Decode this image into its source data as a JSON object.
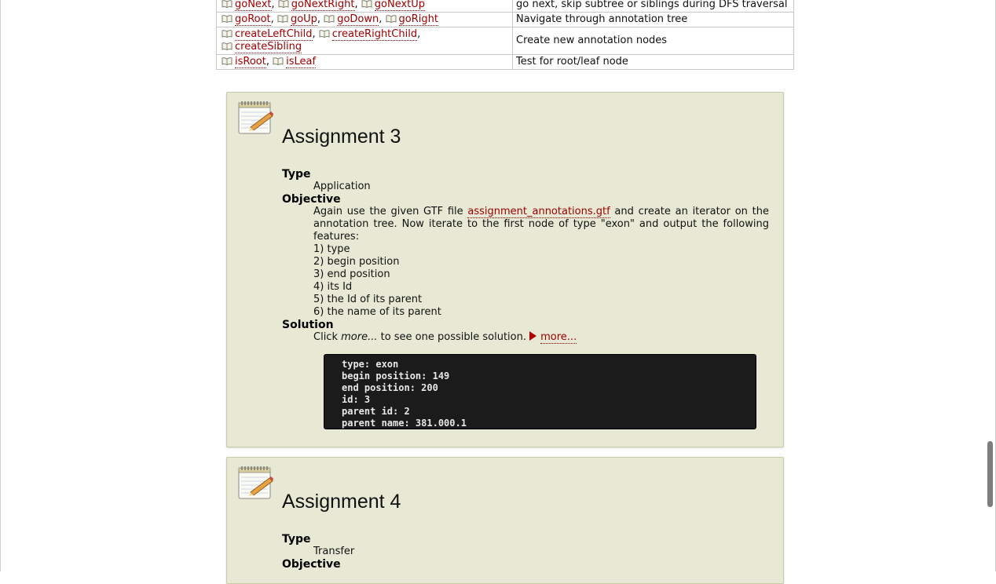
{
  "function_table": {
    "rows": [
      {
        "functions": [
          "goNext",
          "goNextRight",
          "goNextUp"
        ],
        "description": "go next, skip subtree or siblings during DFS traversal"
      },
      {
        "functions": [
          "goRoot",
          "goUp",
          "goDown",
          "goRight"
        ],
        "description": "Navigate through annotation tree"
      },
      {
        "functions": [
          "createLeftChild",
          "createRightChild",
          "createSibling"
        ],
        "description": "Create new annotation nodes"
      },
      {
        "functions": [
          "isRoot",
          "isLeaf"
        ],
        "description": "Test for root/leaf node"
      }
    ]
  },
  "assignment3": {
    "title": "Assignment 3",
    "type_label": "Type",
    "type_value": "Application",
    "objective_label": "Objective",
    "objective_text_1": "Again use the given GTF file ",
    "objective_link": "assignment_annotations.gtf",
    "objective_text_2": " and create an iterator on the annotation tree. Now iterate to the first node of type \"exon\" and output the following features:",
    "features": [
      "1) type",
      "2) begin position",
      "3) end position",
      "4) its Id",
      "5) the Id of its parent",
      "6) the name of its parent"
    ],
    "solution_label": "Solution",
    "solution_prefix": "Click ",
    "solution_em": "more...",
    "solution_suffix": " to see one possible solution.",
    "more_link": "more...",
    "code_lines": [
      "type: exon",
      "begin position: 149",
      "end position: 200",
      "id: 3",
      "parent id: 2",
      "parent name: 381.000.1"
    ]
  },
  "assignment4": {
    "title": "Assignment 4",
    "type_label": "Type",
    "type_value": "Transfer",
    "objective_label": "Objective"
  },
  "colors": {
    "link": "#a00000",
    "box_background": "#e8e9d5",
    "code_background": "#1b1b1b"
  }
}
